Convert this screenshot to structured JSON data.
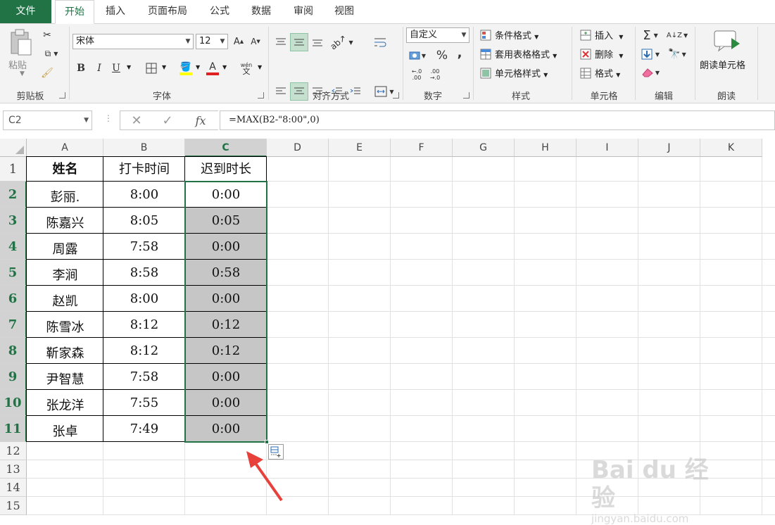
{
  "tabs": [
    "文件",
    "开始",
    "插入",
    "页面布局",
    "公式",
    "数据",
    "审阅",
    "视图"
  ],
  "ribbon": {
    "clipboard": {
      "paste_label": "粘贴",
      "group_label": "剪贴板"
    },
    "font": {
      "font_name": "宋体",
      "font_size": "12",
      "bold": "B",
      "italic": "I",
      "underline": "U",
      "group_label": "字体",
      "phonetic": "wén"
    },
    "alignment": {
      "group_label": "对齐方式"
    },
    "number": {
      "format": "自定义",
      "group_label": "数字",
      "percent": "%",
      "comma": ","
    },
    "styles": {
      "conditional": "条件格式",
      "table": "套用表格格式",
      "cell_styles": "单元格样式",
      "group_label": "样式"
    },
    "cells": {
      "insert": "插入",
      "delete": "删除",
      "format": "格式",
      "group_label": "单元格"
    },
    "editing": {
      "group_label": "编辑"
    },
    "read": {
      "button": "朗读单元格",
      "group_label": "朗读"
    }
  },
  "formula_bar": {
    "name_box": "C2",
    "formula": "=MAX(B2-\"8:00\",0)",
    "fx": "fx"
  },
  "columns": [
    "A",
    "B",
    "C",
    "D",
    "E",
    "F",
    "G",
    "H",
    "I",
    "J",
    "K"
  ],
  "rows": [
    "1",
    "2",
    "3",
    "4",
    "5",
    "6",
    "7",
    "8",
    "9",
    "10",
    "11",
    "12",
    "13",
    "14",
    "15"
  ],
  "table": {
    "headers": [
      "姓名",
      "打卡时间",
      "迟到时长"
    ],
    "data": [
      [
        "彭丽.",
        "8:00",
        "0:00"
      ],
      [
        "陈嘉兴",
        "8:05",
        "0:05"
      ],
      [
        "周露",
        "7:58",
        "0:00"
      ],
      [
        "李涧",
        "8:58",
        "0:58"
      ],
      [
        "赵凯",
        "8:00",
        "0:00"
      ],
      [
        "陈雪冰",
        "8:12",
        "0:12"
      ],
      [
        "靳家森",
        "8:12",
        "0:12"
      ],
      [
        "尹智慧",
        "7:58",
        "0:00"
      ],
      [
        "张龙洋",
        "7:55",
        "0:00"
      ],
      [
        "张卓",
        "7:49",
        "0:00"
      ]
    ]
  },
  "colors": {
    "accent": "#217346",
    "selection_fill": "#c6c6c6",
    "arrow": "#e8413b"
  },
  "watermark": {
    "brand": "Bai du 经验",
    "url": "jingyan.baidu.com"
  }
}
